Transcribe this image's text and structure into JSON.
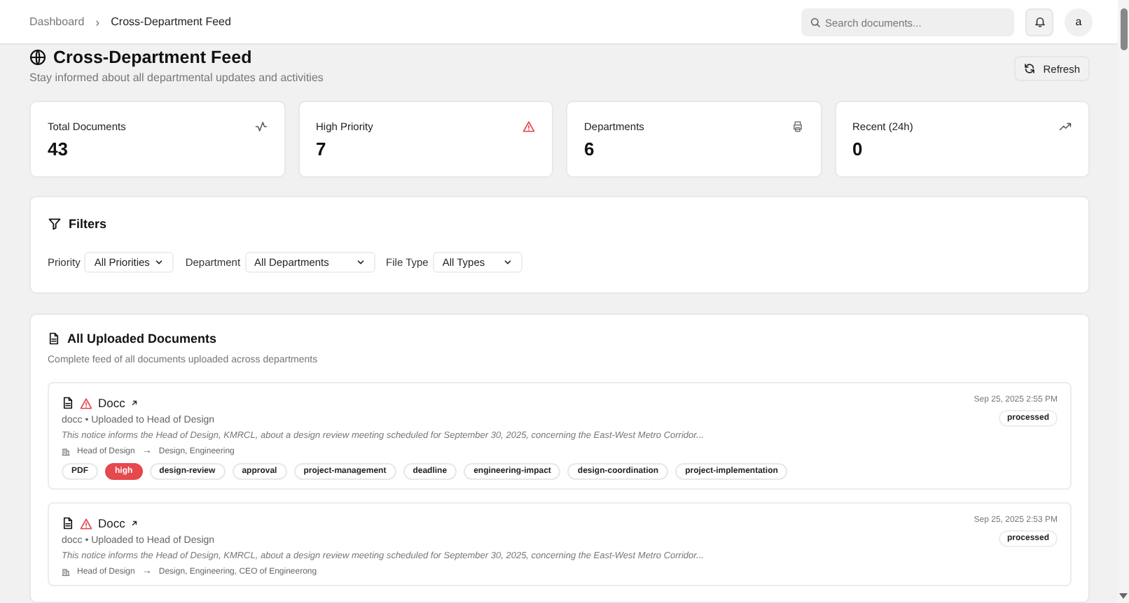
{
  "breadcrumbs": [
    {
      "label": "Dashboard",
      "current": false
    },
    {
      "label": "Cross-Department Feed",
      "current": true
    }
  ],
  "breadcrumb_separator": "›",
  "header": {
    "search_placeholder": "Search documents...",
    "avatar": "a"
  },
  "page": {
    "title": "Cross-Department Feed",
    "subtitle": "Stay informed about all departmental updates and activities",
    "refresh": "Refresh"
  },
  "stats": [
    {
      "label": "Total Documents",
      "value": "43"
    },
    {
      "label": "High Priority",
      "value": "7"
    },
    {
      "label": "Departments",
      "value": "6"
    },
    {
      "label": "Recent (24h)",
      "value": "0"
    }
  ],
  "filters": {
    "title": "Filters",
    "fields": [
      {
        "label": "Priority",
        "value": "All Priorities"
      },
      {
        "label": "Department",
        "value": "All Departments"
      },
      {
        "label": "File Type",
        "value": "All Types"
      }
    ]
  },
  "documents": {
    "title": "All Uploaded Documents",
    "subtitle": "Complete feed of all documents uploaded across departments",
    "items": [
      {
        "title": "Docc",
        "alert": true,
        "meta": "docc • Uploaded to Head of Design",
        "description": "This notice informs the Head of Design, KMRCL, about a design review meeting scheduled for September 30, 2025, concerning the East-West Metro Corridor...",
        "from": "Head of Design",
        "route_arrow": "→",
        "to": "Design, Engineering",
        "date": "Sep 25, 2025 2:55 PM",
        "status": "processed",
        "tags": [
          {
            "text": "PDF",
            "kind": "plain"
          },
          {
            "text": "high",
            "kind": "priority"
          },
          {
            "text": "design-review",
            "kind": "plain"
          },
          {
            "text": "approval",
            "kind": "plain"
          },
          {
            "text": "project-management",
            "kind": "plain"
          },
          {
            "text": "deadline",
            "kind": "plain"
          },
          {
            "text": "engineering-impact",
            "kind": "plain"
          },
          {
            "text": "design-coordination",
            "kind": "plain"
          },
          {
            "text": "project-implementation",
            "kind": "plain"
          }
        ]
      },
      {
        "title": "Docc",
        "alert": true,
        "meta": "docc • Uploaded to Head of Design",
        "description": "This notice informs the Head of Design, KMRCL, about a design review meeting scheduled for September 30, 2025, concerning the East-West Metro Corridor...",
        "from": "Head of Design",
        "route_arrow": "→",
        "to": "Design, Engineering, CEO of Engineerong",
        "date": "Sep 25, 2025 2:53 PM",
        "status": "processed"
      }
    ]
  }
}
